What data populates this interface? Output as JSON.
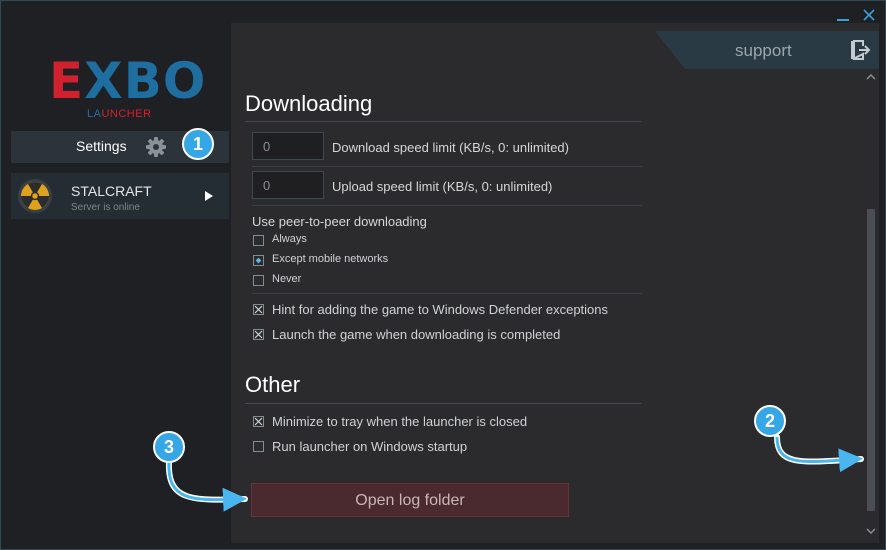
{
  "logo": {
    "e": "E",
    "x": "X",
    "bo": "BO",
    "sub_la": "LA",
    "sub_uncher": "UNCHER"
  },
  "sidebar": {
    "settings_label": "Settings",
    "server": {
      "name": "STALCRAFT",
      "status": "Server is online"
    }
  },
  "header": {
    "support_label": "support"
  },
  "downloading": {
    "title": "Downloading",
    "download_limit": {
      "value": "0",
      "label": "Download speed limit (KB/s, 0: unlimited)"
    },
    "upload_limit": {
      "value": "0",
      "label": "Upload speed limit (KB/s, 0: unlimited)"
    },
    "p2p": {
      "label": "Use peer-to-peer downloading",
      "options": [
        "Always",
        "Except mobile networks",
        "Never"
      ],
      "selected": "Except mobile networks"
    },
    "hint_defender": {
      "label": "Hint for adding the game to Windows Defender exceptions",
      "checked": true
    },
    "launch_after": {
      "label": "Launch the game when downloading is completed",
      "checked": true
    }
  },
  "other": {
    "title": "Other",
    "minimize_tray": {
      "label": "Minimize to tray when the launcher is closed",
      "checked": true
    },
    "run_startup": {
      "label": "Run launcher on Windows startup",
      "checked": false
    },
    "open_log_label": "Open log folder"
  },
  "callouts": {
    "one": "1",
    "two": "2",
    "three": "3"
  },
  "colors": {
    "accent_blue": "#35a6e6",
    "brand_red": "#d1202e",
    "brand_blue": "#1f6ea0",
    "button_red": "#4a2a2e"
  }
}
